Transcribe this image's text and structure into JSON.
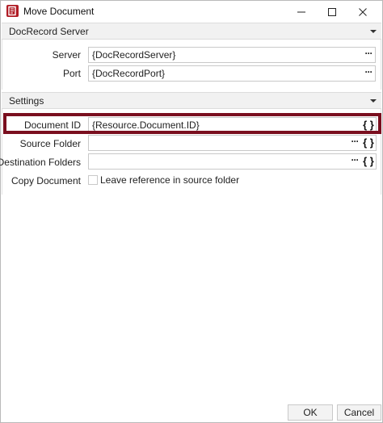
{
  "window": {
    "title": "Move Document",
    "app_icon": "docrecord-logo-icon",
    "controls": {
      "minimize": "—",
      "maximize": "☐",
      "close": "✕"
    }
  },
  "sections": {
    "docrecord_server": {
      "title": "DocRecord Server",
      "server_label": "Server",
      "server_value": "{DocRecordServer}",
      "port_label": "Port",
      "port_value": "{DocRecordPort}"
    },
    "settings": {
      "title": "Settings",
      "document_id_label": "Document ID",
      "document_id_value": "{Resource.Document.ID}",
      "source_folder_label": "Source Folder",
      "source_folder_value": "",
      "destination_folders_label": "Destination Folders",
      "destination_folders_value": "",
      "copy_document_label": "Copy Document",
      "copy_document_checkbox_label": "Leave reference in source folder",
      "copy_document_checked": false
    }
  },
  "icons": {
    "ellipsis": "···",
    "expression": "{ }"
  },
  "buttons": {
    "ok": "OK",
    "cancel": "Cancel"
  },
  "colors": {
    "highlight": "#7a0f1f",
    "brand": "#b01c25"
  }
}
